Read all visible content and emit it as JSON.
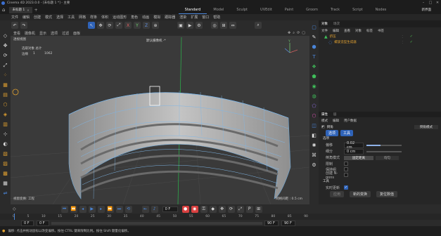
{
  "titlebar": {
    "app_title": "Cinema 4D 2023.0.0 - [未标题 1 *] - 主要",
    "doc_tab": "未标题 1",
    "layouts": [
      "Standard",
      "Model",
      "Sculpt",
      "UVEdit",
      "Paint",
      "Groom",
      "Track",
      "Script",
      "Nodes"
    ],
    "active_layout": "Standard",
    "new_layout": "新界面"
  },
  "menu": [
    "文件",
    "编辑",
    "创建",
    "模式",
    "选择",
    "工具",
    "网格",
    "样条",
    "体积",
    "运动图形",
    "角色",
    "动画",
    "模拟",
    "跟踪器",
    "渲染",
    "扩展",
    "窗口",
    "帮助"
  ],
  "viewport": {
    "top_menu": [
      "查看",
      "摄像机",
      "显示",
      "选项",
      "过滤",
      "面板"
    ],
    "label": "透视视图",
    "camera": "默认摄像机 ·*",
    "stats_title": "选取对象 总计",
    "stats_row_label": "边缘",
    "stats_row_a": "1",
    "stats_row_b": "1062",
    "axis_letter": "Y",
    "bottom_left": "视窗变换: 工程",
    "grid_spacing": "网格间距 : 0.5 cm"
  },
  "objects_panel": {
    "tabs": [
      "对象",
      "场次"
    ],
    "menu": [
      "文件",
      "编辑",
      "查看",
      "对象",
      "标签",
      "书签"
    ],
    "items": [
      {
        "name": "挤压"
      },
      {
        "name": "螺旋造型生成器"
      }
    ]
  },
  "attributes_panel": {
    "tabs": [
      "属性",
      "层"
    ],
    "menu": [
      "模式",
      "编辑",
      "用户数据"
    ],
    "tool_name": "倒角",
    "mode_dropdown": "倒角模式",
    "subtabs": [
      "选项",
      "工具"
    ],
    "section_options": "选项",
    "fields": [
      {
        "label": "偏移",
        "value": "0.02 cm",
        "fill_fraction": 0.4
      },
      {
        "label": "细分",
        "value": "0 cm",
        "fill_fraction": 0.0
      }
    ],
    "bevel_mode_label": "倒角模式",
    "bevel_mode_value": "固定距离",
    "bevel_mode_right": "均匀",
    "chk_labels": [
      "限制",
      "保持组",
      "创建 N-gons"
    ],
    "section_tools": "工具",
    "realtime_label": "实时更新",
    "btn_apply": "应用",
    "btn_new": "新的变换",
    "btn_reset": "复位数值"
  },
  "timeline": {
    "ticks": [
      "0",
      "5",
      "10",
      "15",
      "20",
      "25",
      "30",
      "35",
      "40",
      "45",
      "50",
      "55",
      "60",
      "65",
      "70",
      "75",
      "80",
      "85",
      "90"
    ],
    "frame_start": "0 F",
    "frame_end": "90 F",
    "current_frame": "0 F",
    "range_start": "0 F",
    "range_end": "90 F",
    "range_end2": "90 F"
  },
  "status": "偏移: 点击并拖动鼠标以改变偏移。按住 CTRL 键来限制比例。按住 Shift 键量化偏移。",
  "colors": {
    "accent": "#4a86d9",
    "blue_btn": "#2f63b8",
    "record_red": "#d94040"
  }
}
